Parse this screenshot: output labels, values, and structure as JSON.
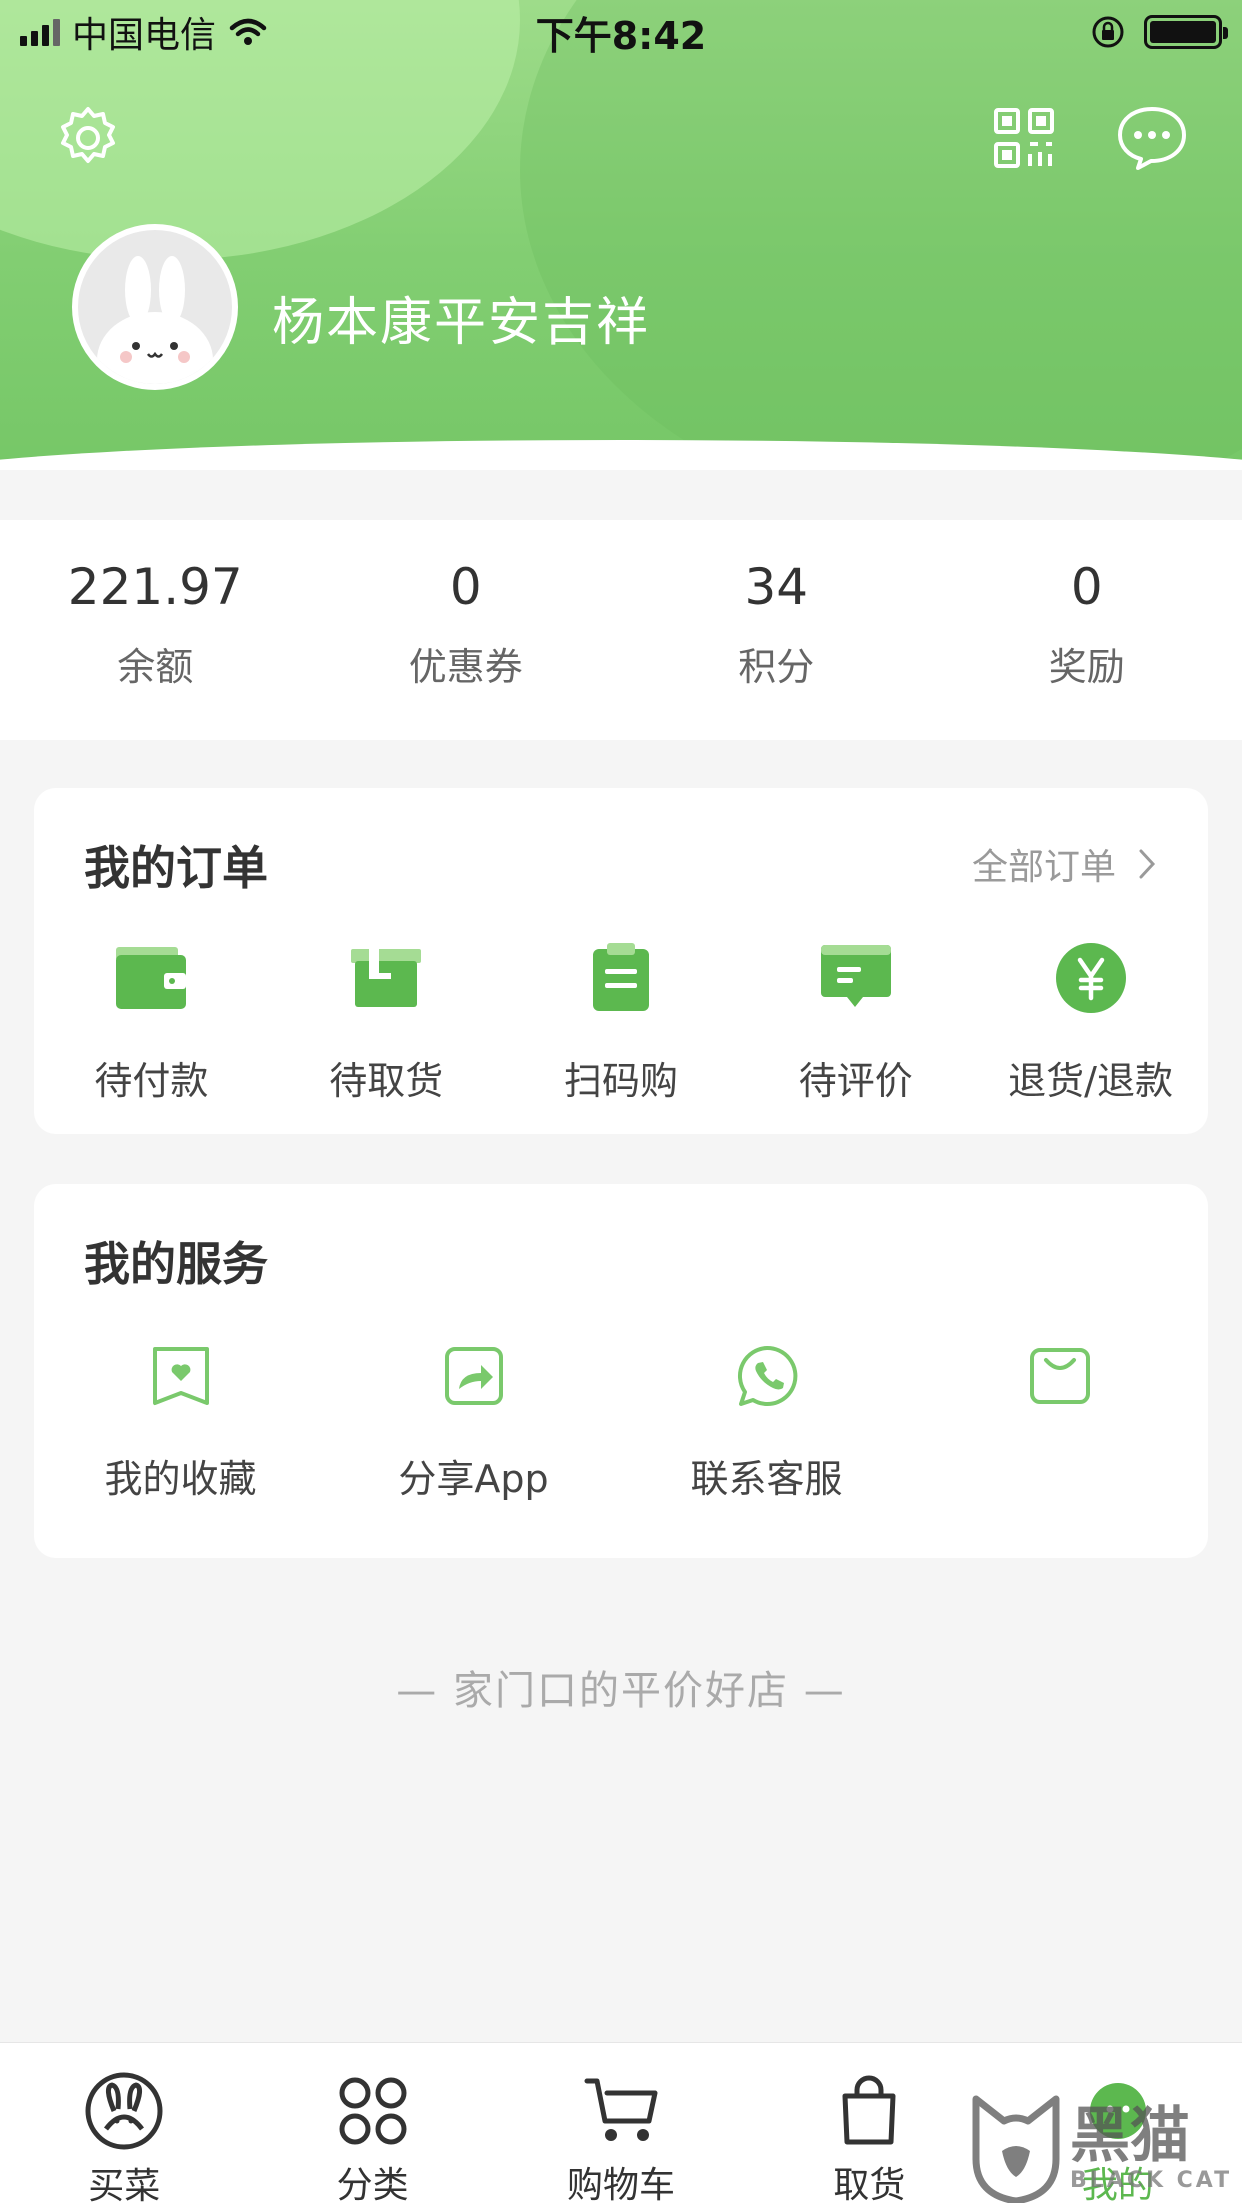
{
  "status_bar": {
    "carrier": "中国电信",
    "time": "下午8:42"
  },
  "header": {
    "settings_icon": "gear-icon",
    "qrcode_icon": "qrcode-icon",
    "message_icon": "chat-bubble-icon",
    "username": "杨本康平安吉祥",
    "avatar_icon": "bunny-avatar"
  },
  "stats": [
    {
      "value": "221.97",
      "label": "余额"
    },
    {
      "value": "0",
      "label": "优惠券"
    },
    {
      "value": "34",
      "label": "积分"
    },
    {
      "value": "0",
      "label": "奖励"
    }
  ],
  "orders": {
    "title": "我的订单",
    "all_link": "全部订单",
    "items": [
      {
        "label": "待付款",
        "icon": "wallet-icon"
      },
      {
        "label": "待取货",
        "icon": "package-icon"
      },
      {
        "label": "扫码购",
        "icon": "clipboard-icon"
      },
      {
        "label": "待评价",
        "icon": "comment-icon"
      },
      {
        "label": "退货/退款",
        "icon": "yen-icon"
      }
    ]
  },
  "services": {
    "title": "我的服务",
    "items": [
      {
        "label": "我的收藏",
        "icon": "favorite-icon"
      },
      {
        "label": "分享App",
        "icon": "share-icon"
      },
      {
        "label": "联系客服",
        "icon": "phone-chat-icon"
      },
      {
        "label": "",
        "icon": "shopping-bag-icon"
      }
    ]
  },
  "slogan": "— 家门口的平价好店 —",
  "tabbar": [
    {
      "label": "买菜",
      "icon": "bunny-icon"
    },
    {
      "label": "分类",
      "icon": "grid-icon"
    },
    {
      "label": "购物车",
      "icon": "cart-icon"
    },
    {
      "label": "取货",
      "icon": "bag-icon"
    },
    {
      "label": "我的",
      "icon": "profile-icon",
      "active": true
    }
  ],
  "watermark": {
    "cn": "黑猫",
    "en": "BLACK CAT"
  },
  "colors": {
    "brand_green": "#76c767",
    "icon_green": "#5cb84f"
  }
}
